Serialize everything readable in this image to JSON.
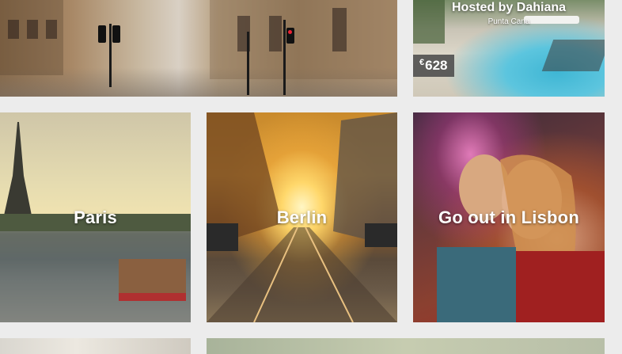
{
  "listing": {
    "host_label": "Hosted by Dahiana",
    "location": "Punta Cana",
    "price_currency": "€",
    "price_amount": "628"
  },
  "destinations": [
    {
      "label": "Paris"
    },
    {
      "label": "Berlin"
    },
    {
      "label": "Go out in Lisbon"
    }
  ]
}
